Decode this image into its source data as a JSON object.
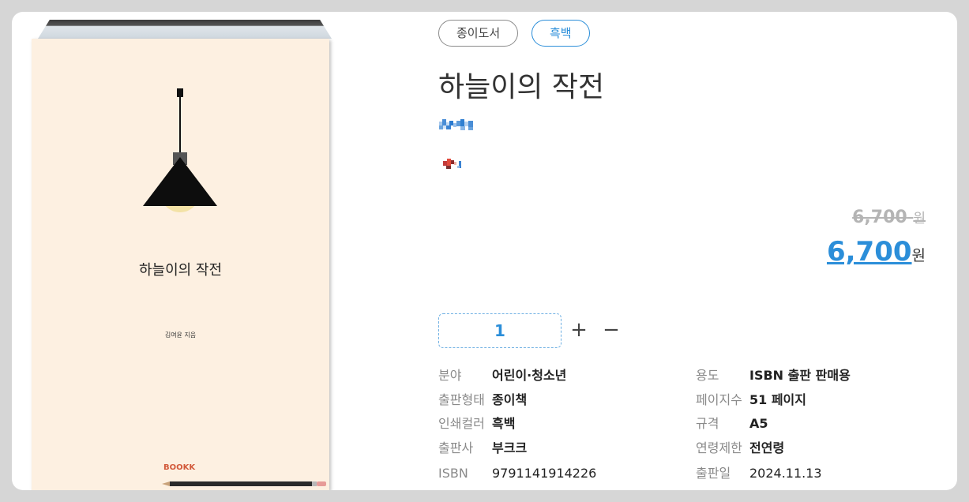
{
  "cover": {
    "title": "하늘이의 작전",
    "author": "김여윤 지음",
    "brand": "BOOKK"
  },
  "chips": {
    "type": "종이도서",
    "color": "흑백"
  },
  "book": {
    "title": "하늘이의 작전"
  },
  "price": {
    "original": "6,700",
    "original_unit": "원",
    "current": "6,700",
    "current_unit": "원"
  },
  "quantity": {
    "value": "1",
    "plus": "+",
    "minus": "−"
  },
  "specs": {
    "left": [
      {
        "label": "분야",
        "value": "어린이·청소년"
      },
      {
        "label": "출판형태",
        "value": "종이책"
      },
      {
        "label": "인쇄컬러",
        "value": "흑백"
      },
      {
        "label": "출판사",
        "value": "부크크"
      },
      {
        "label": "ISBN",
        "value": "9791141914226"
      }
    ],
    "right": [
      {
        "label": "용도",
        "value": "ISBN 출판 판매용"
      },
      {
        "label": "페이지수",
        "value": "51 페이지"
      },
      {
        "label": "규격",
        "value": "A5"
      },
      {
        "label": "연령제한",
        "value": "전연령"
      },
      {
        "label": "출판일",
        "value": "2024.11.13"
      }
    ]
  },
  "colors": {
    "accent": "#2b8ed9",
    "cover_bg": "#fdf0e1"
  }
}
